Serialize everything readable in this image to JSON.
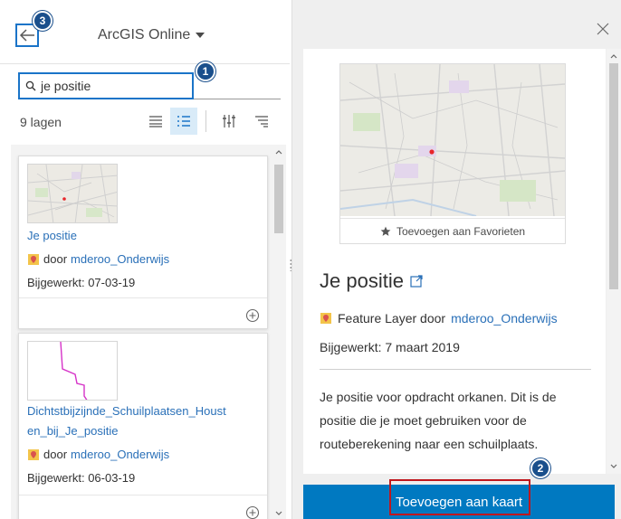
{
  "header": {
    "source_label": "ArcGIS Online",
    "step_badges": [
      "1",
      "2",
      "3"
    ]
  },
  "search": {
    "value": "je positie"
  },
  "results": {
    "count_label": "9 lagen",
    "items": [
      {
        "title": "Je positie",
        "owner_prefix": "door",
        "owner": "mderoo_Onderwijs",
        "updated": "Bijgewerkt: 07-03-19"
      },
      {
        "title_line1": "Dichtstbijzijnde_Schuilplaatsen_Houst",
        "title_line2": "en_bij_Je_positie",
        "owner_prefix": "door",
        "owner": "mderoo_Onderwijs",
        "updated": "Bijgewerkt: 06-03-19"
      }
    ]
  },
  "detail": {
    "favorite_label": "Toevoegen aan Favorieten",
    "title": "Je positie",
    "type_prefix": "Feature Layer door",
    "owner": "mderoo_Onderwijs",
    "updated": "Bijgewerkt: 7 maart 2019",
    "description": "Je positie voor opdracht orkanen. Dit is de positie die je moet gebruiken voor de routeberekening naar een schuilplaats.",
    "add_to_map_label": "Toevoegen aan kaart"
  },
  "colors": {
    "accent": "#0079c1",
    "link": "#2a70b8",
    "badge": "#1a4f8c",
    "highlight": "#c0171d"
  }
}
